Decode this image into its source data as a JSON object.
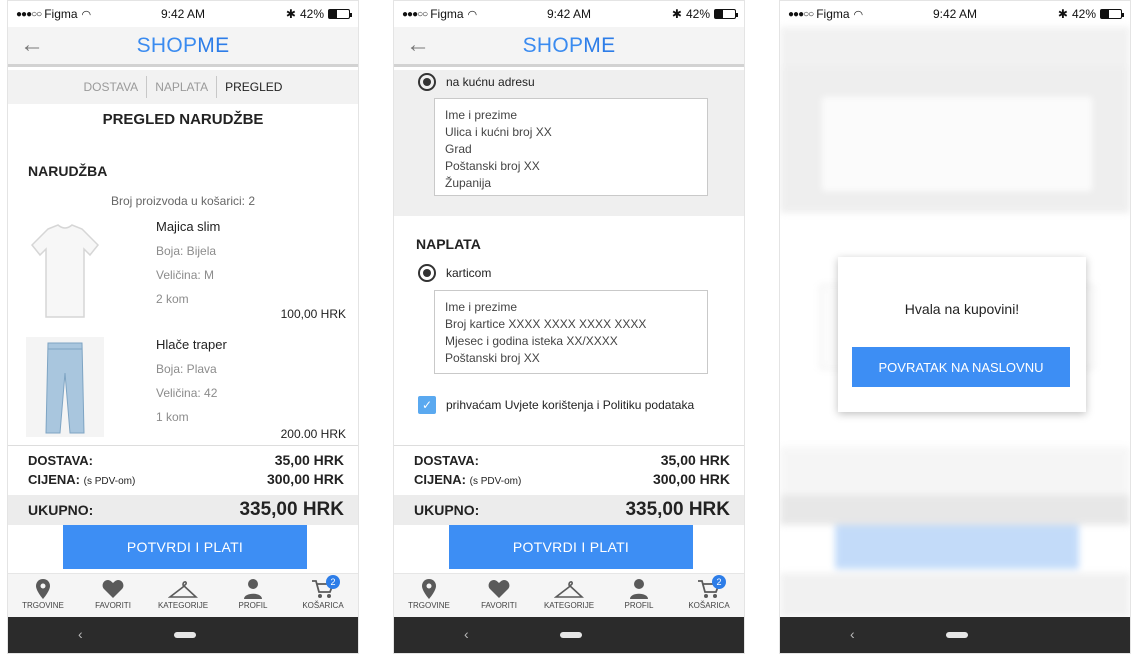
{
  "status": {
    "carrier": "Figma",
    "time": "9:42 AM",
    "battery": "42%"
  },
  "app": {
    "title_a": "SHOP",
    "title_b": "ME"
  },
  "steps": [
    "DOSTAVA",
    "NAPLATA",
    "PREGLED"
  ],
  "review": {
    "heading": "PREGLED NARUDŽBE",
    "order_heading": "NARUDŽBA",
    "cart_count": "Broj proizvoda u košarici: 2",
    "products": [
      {
        "name": "Majica slim",
        "color": "Boja: Bijela",
        "size": "Veličina: M",
        "qty": "2 kom",
        "price": "100,00 HRK"
      },
      {
        "name": "Hlače traper",
        "color": "Boja: Plava",
        "size": "Veličina: 42",
        "qty": "1 kom",
        "price": "200.00 HRK"
      }
    ]
  },
  "delivery": {
    "option_label": "na kućnu adresu",
    "address_lines": [
      "Ime i prezime",
      "Ulica i kućni broj XX",
      "Grad",
      "Poštanski broj XX",
      "Županija"
    ]
  },
  "payment": {
    "heading": "NAPLATA",
    "option_label": "karticom",
    "card_lines": [
      "Ime i prezime",
      "Broj kartice XXXX XXXX XXXX XXXX",
      "Mjesec  i godina isteka XX/XXXX",
      "Poštanski broj XX"
    ],
    "terms_label": "prihvaćam Uvjete korištenja i Politiku podataka"
  },
  "totals": {
    "delivery_label": "DOSTAVA:",
    "delivery_value": "35,00 HRK",
    "price_label": "CIJENA:",
    "price_note": "(s PDV-om)",
    "price_value": "300,00 HRK",
    "total_label": "UKUPNO:",
    "total_value": "335,00 HRK"
  },
  "cta_label": "POTVRDI I PLATI",
  "tabs": [
    "TRGOVINE",
    "FAVORITI",
    "KATEGORIJE",
    "PROFIL",
    "KOŠARICA"
  ],
  "cart_badge": "2",
  "modal": {
    "message": "Hvala na kupovini!",
    "button": "POVRATAK NA NASLOVNU"
  },
  "colors": {
    "accent": "#3d8ef4",
    "badge": "#2d7de8"
  }
}
